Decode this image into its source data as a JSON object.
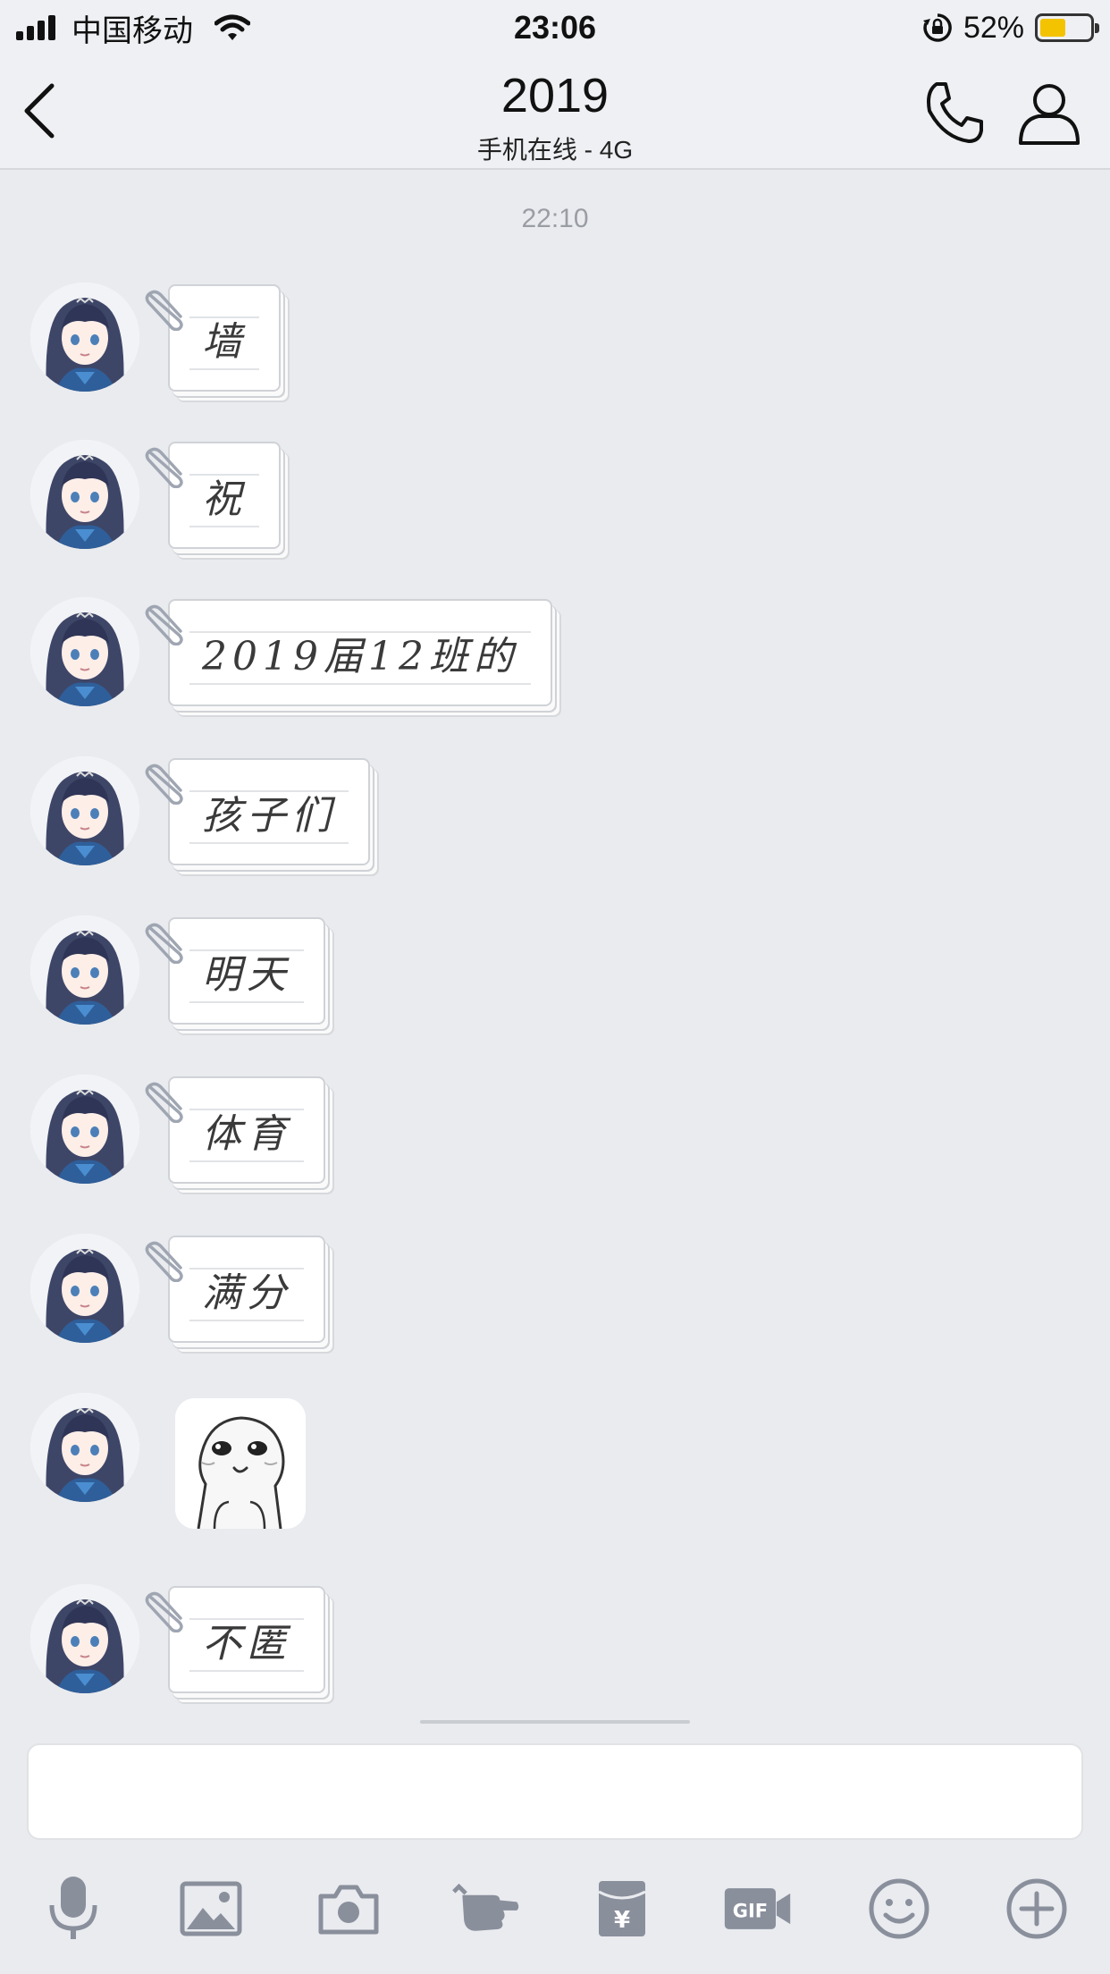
{
  "status_bar": {
    "carrier": "中国移动",
    "time": "23:06",
    "battery_percent_label": "52%",
    "battery_level": 0.52,
    "battery_color": "#f4c300"
  },
  "nav": {
    "title": "2019",
    "subtitle": "手机在线 - 4G"
  },
  "chat": {
    "timestamp": "22:10",
    "messages": [
      {
        "type": "text",
        "text": "墙"
      },
      {
        "type": "text",
        "text": "祝"
      },
      {
        "type": "text",
        "text": "2019届12班的"
      },
      {
        "type": "text",
        "text": "孩子们"
      },
      {
        "type": "text",
        "text": "明天"
      },
      {
        "type": "text",
        "text": "体育"
      },
      {
        "type": "text",
        "text": "满分"
      },
      {
        "type": "sticker",
        "text": ""
      },
      {
        "type": "text",
        "text": "不匿"
      }
    ]
  },
  "input": {
    "placeholder": ""
  },
  "toolbar": {
    "icons": [
      "microphone-icon",
      "image-icon",
      "camera-icon",
      "poke-icon",
      "red-packet-icon",
      "gif-icon",
      "emoji-icon",
      "plus-icon"
    ],
    "icon_color": "#8a8f9c"
  }
}
